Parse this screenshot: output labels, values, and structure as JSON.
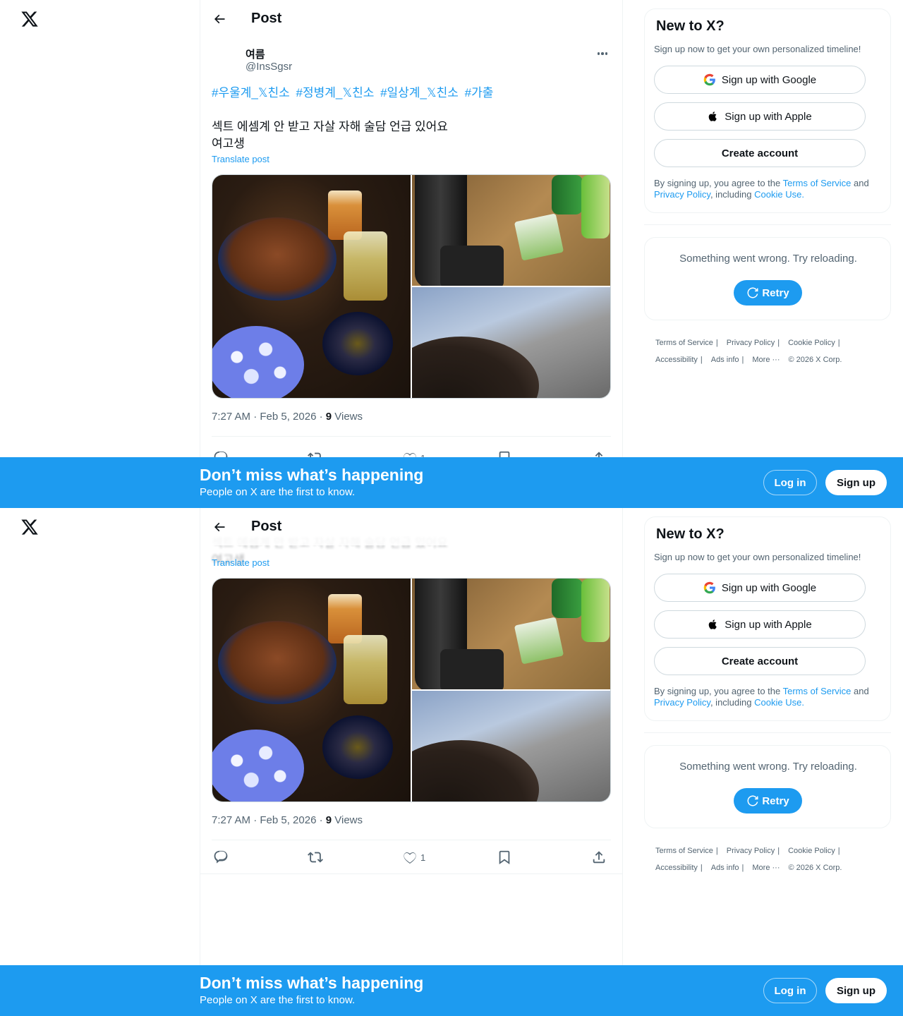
{
  "header": {
    "title": "Post",
    "back_icon": "arrow-left-icon",
    "logo_icon": "x-logo-icon"
  },
  "post": {
    "display_name": "여름",
    "handle": "@InsSgsr",
    "hashtags": [
      "#우울계_𝕏친소",
      "#정병계_𝕏친소",
      "#일상계_𝕏친소",
      "#가출"
    ],
    "body": "섹트 에셈계 안 받고 자살 자해 술담 언급 있어요\n여고생",
    "translate_label": "Translate post",
    "time": "7:27 AM · Feb 5, 2026 · ",
    "views_count": "9",
    "views_label": " Views",
    "like_count": "1"
  },
  "signup": {
    "title": "New to X?",
    "subtitle": "Sign up now to get your own personalized timeline!",
    "google_label": "Sign up with Google",
    "apple_label": "Sign up with Apple",
    "create_label": "Create account",
    "terms_prefix": "By signing up, you agree to the ",
    "terms_link": "Terms of Service",
    "terms_and": " and ",
    "privacy_link": "Privacy Policy",
    "terms_including": ", including ",
    "cookie_link": "Cookie Use",
    "terms_end": "."
  },
  "error": {
    "message": "Something went wrong. Try reloading.",
    "retry_label": "Retry"
  },
  "footer": {
    "terms": "Terms of Service",
    "privacy": "Privacy Policy",
    "cookie": "Cookie Policy",
    "accessibility": "Accessibility",
    "ads": "Ads info",
    "more": "More ···",
    "copyright": "© 2026 X Corp."
  },
  "banner": {
    "title": "Don’t miss what’s happening",
    "subtitle": "People on X are the first to know.",
    "login_label": "Log in",
    "signup_label": "Sign up"
  },
  "colors": {
    "accent": "#1d9bf0",
    "text": "#0f1419",
    "muted": "#536471",
    "border": "#eff3f4"
  }
}
